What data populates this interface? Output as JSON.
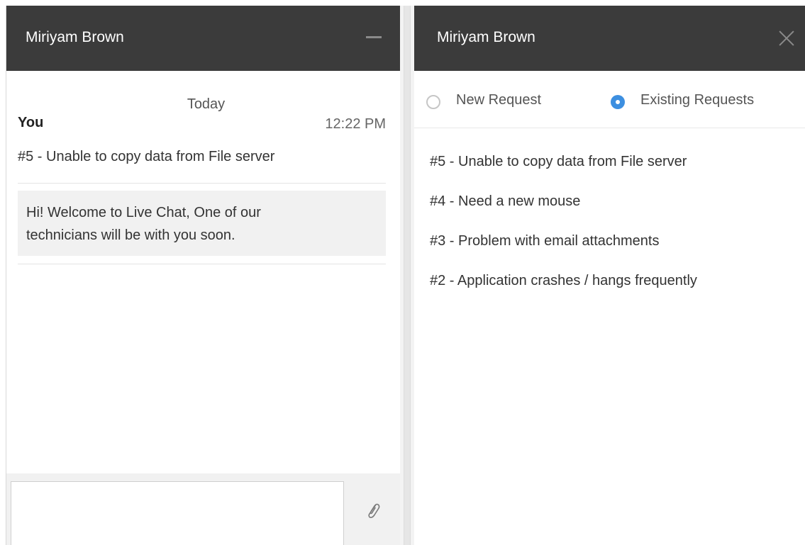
{
  "chat": {
    "title": "Miriyam Brown",
    "date_separator": "Today",
    "sender": "You",
    "time": "12:22 PM",
    "message": "#5 - Unable to copy data from File server",
    "welcome_lines": [
      "Hi! Welcome to Live Chat, One of our",
      "technicians will be with you soon."
    ],
    "input_value": "",
    "icons": {
      "minimize": "minimize-icon",
      "attach": "paperclip-icon"
    }
  },
  "requests": {
    "title": "Miriyam Brown",
    "options": [
      {
        "label": "New Request",
        "selected": false
      },
      {
        "label": "Existing Requests",
        "selected": true
      }
    ],
    "items": [
      "#5 - Unable to copy data from File server",
      "#4 - Need a new mouse",
      "#3 - Problem with email attachments",
      "#2 - Application crashes / hangs frequently"
    ],
    "icons": {
      "close": "close-icon"
    }
  },
  "colors": {
    "header_bg": "#3b3b3b",
    "accent": "#3d8fe0",
    "message_bg": "#f1f1f1"
  }
}
